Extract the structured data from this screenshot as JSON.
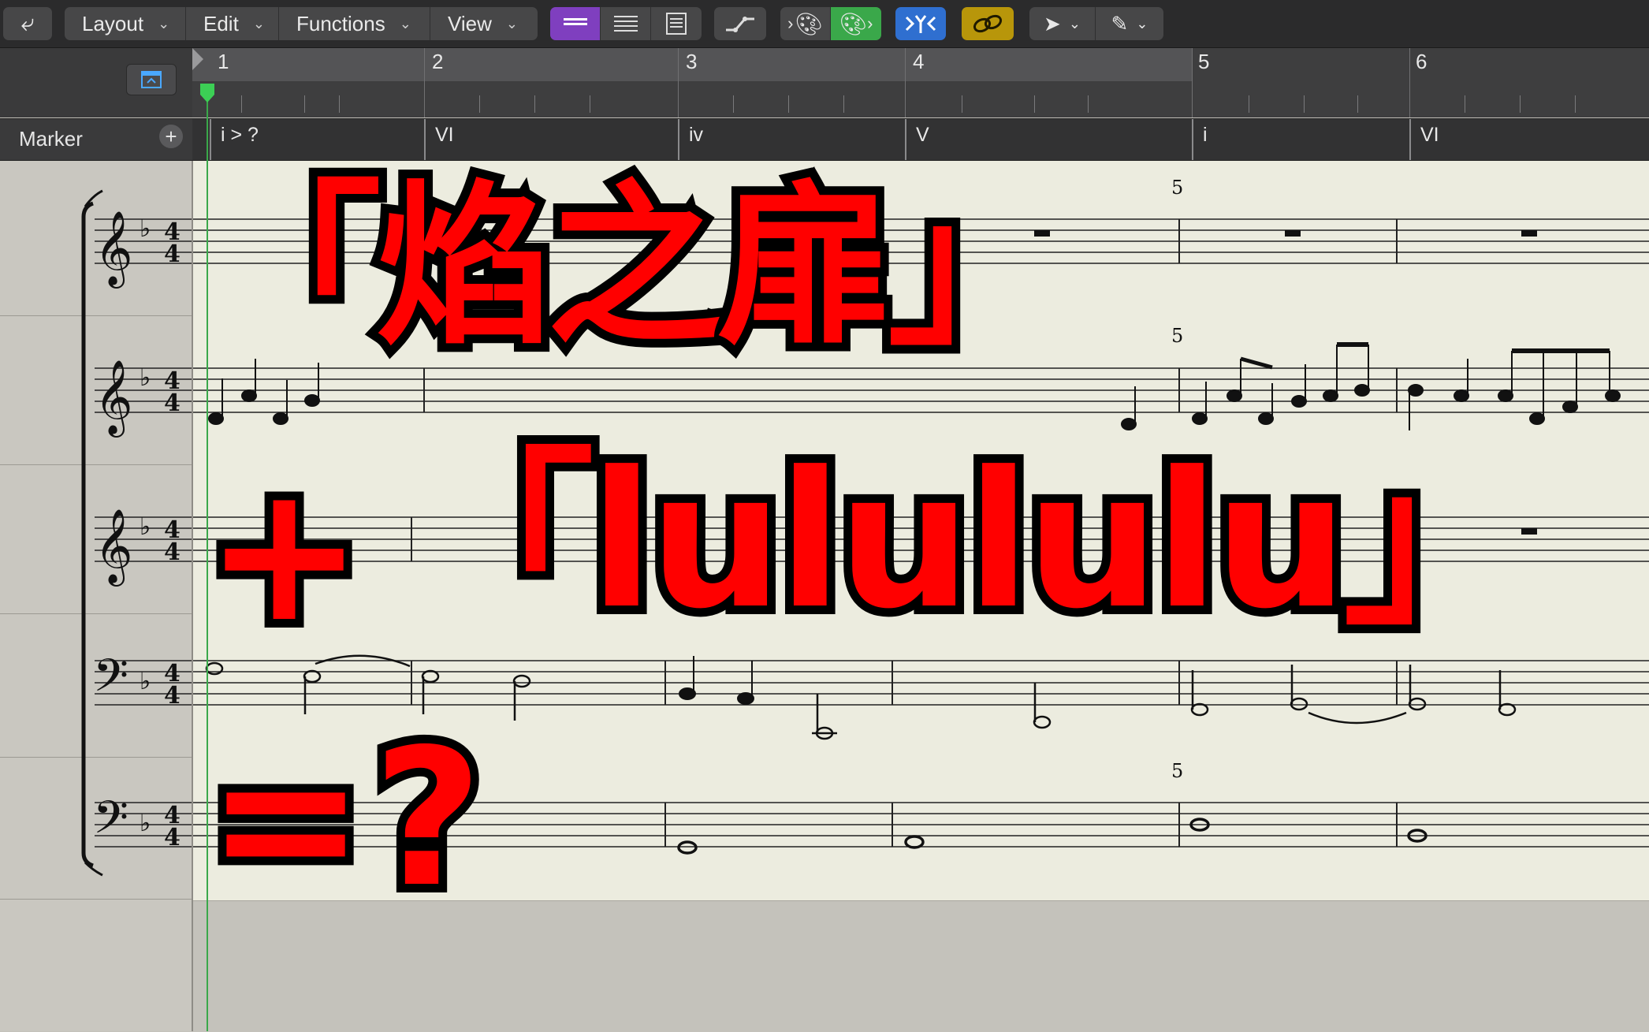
{
  "toolbar": {
    "back_icon": "catch-up-arrow-icon",
    "menus": [
      {
        "label": "Layout"
      },
      {
        "label": "Edit"
      },
      {
        "label": "Functions"
      },
      {
        "label": "View"
      }
    ],
    "view_modes": [
      "linear-view-icon",
      "page-view-icon",
      "score-set-icon"
    ],
    "colors": {
      "accent_purple": "#7f3fbf",
      "accent_green": "#3aa84a",
      "accent_blue": "#2f6fd0",
      "accent_gold": "#b8960a"
    }
  },
  "ruler": {
    "bars": [
      "1",
      "2",
      "3",
      "4",
      "5",
      "6"
    ]
  },
  "marker_track": {
    "label": "Marker",
    "add_icon": "plus-icon",
    "markers": [
      "i > ?",
      "VI",
      "iv",
      "V",
      "i",
      "VI"
    ]
  },
  "score": {
    "measure_numbers": [
      "5",
      "5",
      "5"
    ],
    "staves": [
      {
        "clef": "treble"
      },
      {
        "clef": "treble"
      },
      {
        "clef": "treble"
      },
      {
        "clef": "bass"
      },
      {
        "clef": "bass"
      }
    ]
  },
  "overlay": {
    "line1": "「焰之扉」",
    "line2_plus": "+",
    "line2_text": "「lulululu」",
    "line3": "=?"
  }
}
